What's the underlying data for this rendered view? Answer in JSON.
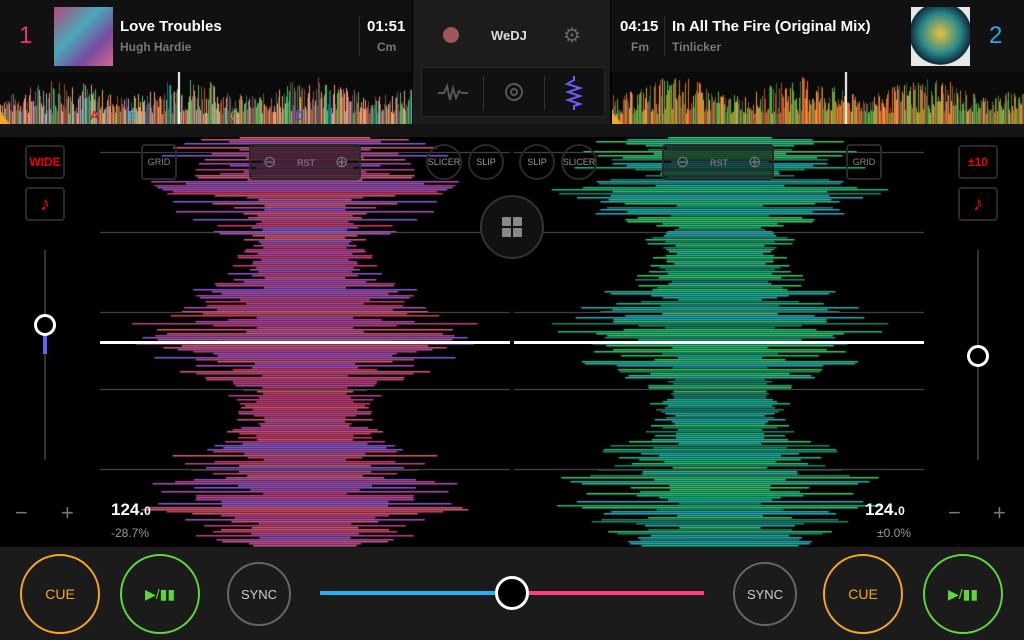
{
  "deck1": {
    "number": "1",
    "title": "Love Troubles",
    "artist": "Hugh Hardie",
    "time": "01:51",
    "key": "Cm",
    "bpm": "124.",
    "bpm_dec": "0",
    "pitch": "-28.7%",
    "cues": [
      "A",
      "B",
      "C",
      "D"
    ],
    "wide_label": "WIDE",
    "pitch_position": 0.35,
    "color": "#e8336b"
  },
  "deck2": {
    "number": "2",
    "title": "In All The Fire (Original Mix)",
    "artist": "Tinlicker",
    "time": "04:15",
    "key": "Fm",
    "bpm": "124.",
    "bpm_dec": "0",
    "pitch": "±0.0%",
    "range_label": "±10",
    "pitch_position": 0.5,
    "color": "#2aa8e0"
  },
  "center": {
    "logo": "WeDJ"
  },
  "controls": {
    "grid": "GRID",
    "rst": "RST",
    "slicer": "SLICER",
    "slip": "SLIP",
    "cue": "CUE",
    "play": "▶/▮▮",
    "sync": "SYNC",
    "minus": "−",
    "plus": "+"
  },
  "crossfader": {
    "position": 0.5
  },
  "colors": {
    "cue": "#f5a623",
    "play": "#5fd63a",
    "left": "#2ab0f0",
    "right": "#ff3d7f"
  }
}
